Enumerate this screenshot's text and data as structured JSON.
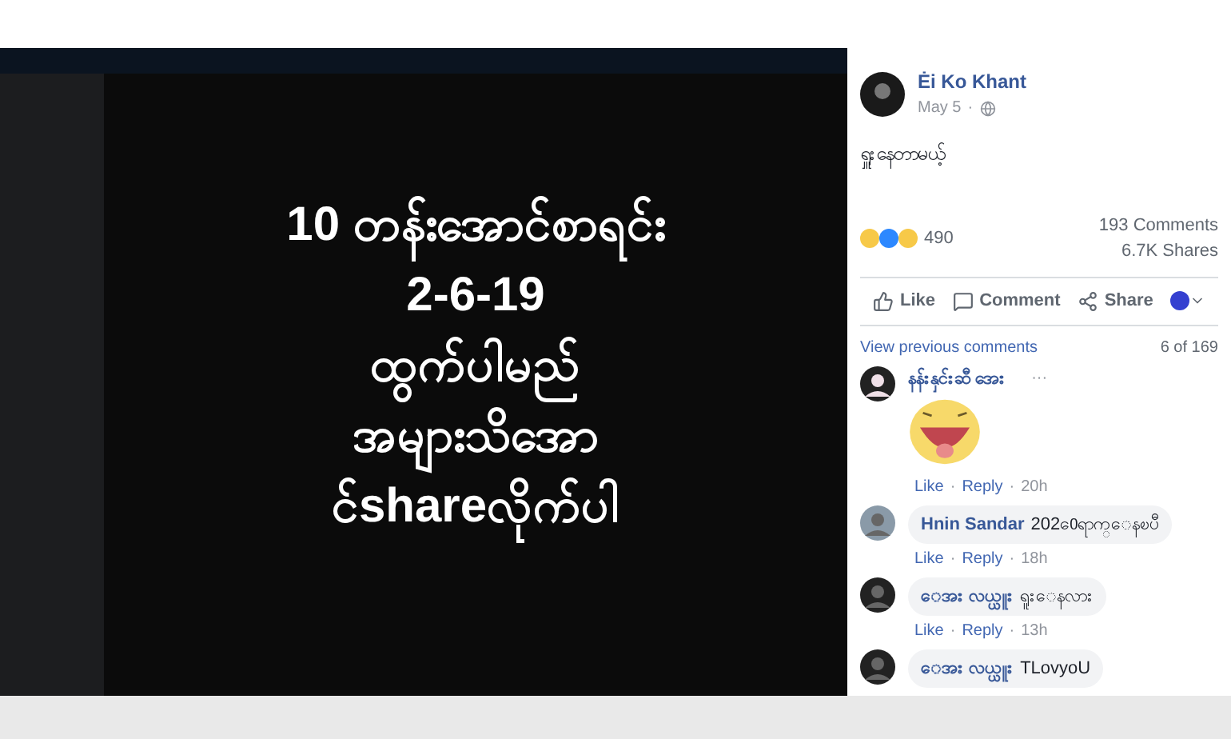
{
  "image": {
    "lines": [
      "10 တန်းအောင်စာရင်း",
      "2-6-19",
      "ထွက်ပါမည်",
      "အများသိအော",
      "င်shareလိုက်ပါ"
    ]
  },
  "post": {
    "author": "Ėi Ko Khant",
    "date": "May 5",
    "separator": "·",
    "text": "ရှူးနေတာမယ့်",
    "reaction_count": "490",
    "comments": "193 Comments",
    "shares": "6.7K Shares"
  },
  "actions": [
    "Like",
    "Comment",
    "Share"
  ],
  "meta_separator": "·",
  "view_previous": "View previous comments",
  "comment_count": "6 of 169",
  "more": "···",
  "comments": [
    {
      "kind": "sticker",
      "author": "နန်းနှင်းဆီ အေး",
      "meta": [
        "Like",
        "Reply",
        "20h"
      ]
    },
    {
      "kind": "text",
      "author": "Hnin Sandar",
      "text": "2020ေရာက္ေနၿပီ",
      "meta": [
        "Like",
        "Reply",
        "18h"
      ]
    },
    {
      "kind": "text",
      "author": "ေအး လယ္ယူး",
      "text": "ရူးေနလား",
      "meta": [
        "Like",
        "Reply",
        "13h"
      ]
    },
    {
      "kind": "text",
      "author": "ေအး လယ္ယူး",
      "text": "TLovyoU"
    }
  ]
}
